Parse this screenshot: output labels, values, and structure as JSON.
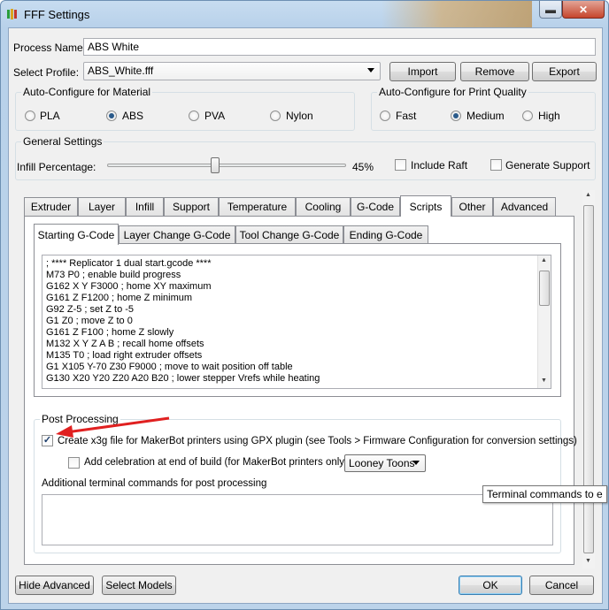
{
  "window": {
    "title": "FFF Settings",
    "min_symbol": "▬",
    "close_symbol": "✕",
    "accent": "#3c7fb1",
    "icon": "simplify3d-icon"
  },
  "process": {
    "name_label": "Process Name:",
    "name_value": "ABS White",
    "profile_label": "Select Profile:",
    "profile_value": "ABS_White.fff"
  },
  "buttons": {
    "import": "Import",
    "remove": "Remove",
    "export": "Export",
    "hide_advanced": "Hide Advanced",
    "select_models": "Select Models",
    "ok": "OK",
    "cancel": "Cancel"
  },
  "material": {
    "title": "Auto-Configure for Material",
    "options": [
      "PLA",
      "ABS",
      "PVA",
      "Nylon"
    ],
    "selected": "ABS"
  },
  "quality": {
    "title": "Auto-Configure for Print Quality",
    "options": [
      "Fast",
      "Medium",
      "High"
    ],
    "selected": "Medium"
  },
  "general": {
    "title": "General Settings",
    "infill_label": "Infill Percentage:",
    "infill_value": "45%",
    "infill_fraction": 0.45,
    "include_raft": "Include Raft",
    "generate_support": "Generate Support"
  },
  "tabs": [
    "Extruder",
    "Layer",
    "Infill",
    "Support",
    "Temperature",
    "Cooling",
    "G-Code",
    "Scripts",
    "Other",
    "Advanced"
  ],
  "active_tab": "Scripts",
  "subtabs": [
    "Starting G-Code",
    "Layer Change G-Code",
    "Tool Change G-Code",
    "Ending G-Code"
  ],
  "active_subtab": "Starting G-Code",
  "gcode_lines": [
    "; **** Replicator 1 dual start.gcode ****",
    "M73 P0 ; enable build progress",
    "G162 X Y F3000 ; home XY maximum",
    "G161 Z F1200 ; home Z minimum",
    "G92 Z-5 ; set Z to -5",
    "G1 Z0 ; move Z to 0",
    "G161 Z F100 ; home Z slowly",
    "M132 X Y Z A B ; recall home offsets",
    "M135 T0 ; load right extruder offsets",
    "G1 X105 Y-70 Z30 F9000 ; move to wait position off table",
    "G130 X20 Y20 Z20 A20 B20 ; lower stepper Vrefs while heating"
  ],
  "post": {
    "title": "Post Processing",
    "create_x3g": "Create x3g file for MakerBot printers using GPX plugin (see Tools > Firmware Configuration for conversion settings)",
    "celebration": "Add celebration at end of build (for MakerBot printers only)",
    "celebration_option": "Looney Toons",
    "terminal_label": "Additional terminal commands for post processing",
    "tooltip": "Terminal commands to e"
  }
}
